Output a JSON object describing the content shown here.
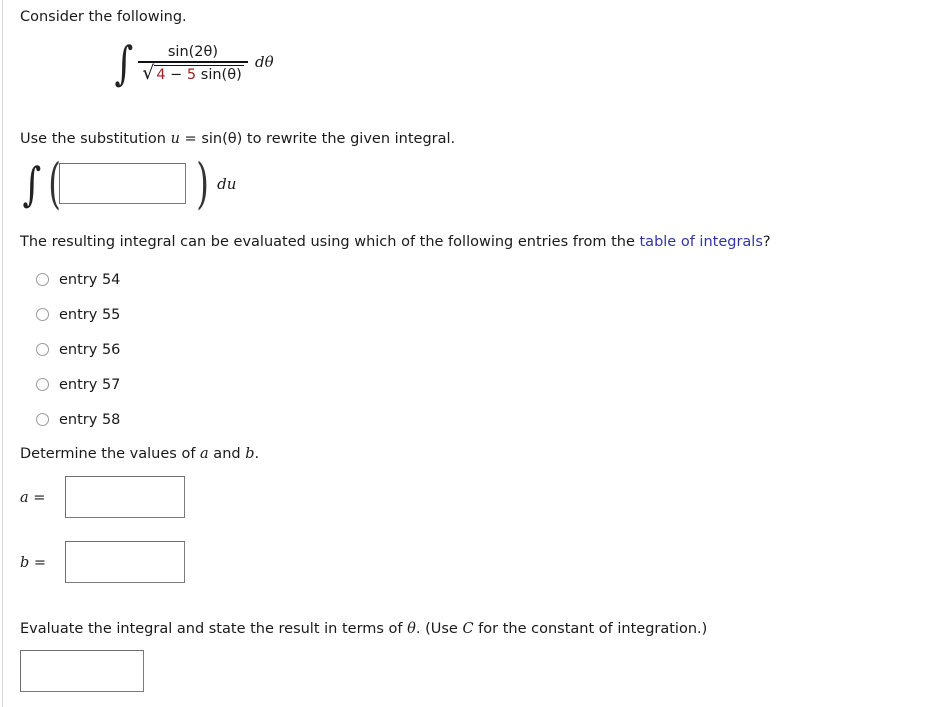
{
  "intro": {
    "text": "Consider the following."
  },
  "integral": {
    "integral_sign": "∫",
    "numerator": "sin(2θ)",
    "sqrt_glyph": "√",
    "denominator_a": "4",
    "denominator_op": " − ",
    "denominator_b": "5",
    "denominator_rest": " sin(θ)",
    "differential": "dθ"
  },
  "substitution": {
    "prefix": "Use the substitution ",
    "variable": "u",
    "equals": " = ",
    "expression": "sin(θ)",
    "suffix": " to rewrite the given integral.",
    "integral_sign": "∫",
    "open_paren": "(",
    "close_paren": ")",
    "differential": "du",
    "input_value": "",
    "input_placeholder": ""
  },
  "question": {
    "text_before_link": "The resulting integral can be evaluated using which of the following entries from the ",
    "link_text": "table of integrals",
    "text_after_link": "?",
    "link_color": "#3333a8",
    "options": [
      {
        "label": "entry 54",
        "selected": false
      },
      {
        "label": "entry 55",
        "selected": false
      },
      {
        "label": "entry 56",
        "selected": false
      },
      {
        "label": "entry 57",
        "selected": false
      },
      {
        "label": "entry 58",
        "selected": false
      }
    ]
  },
  "determine": {
    "prefix": "Determine the values of ",
    "var_a": "a",
    "conjunction": " and ",
    "var_b": "b",
    "period": ".",
    "a_label_var": "a",
    "a_label_eq": " =",
    "b_label_var": "b",
    "b_label_eq": " =",
    "a_value": "",
    "b_value": "",
    "a_placeholder": "",
    "b_placeholder": ""
  },
  "evaluate": {
    "text_1": "Evaluate the integral and state the result in terms of ",
    "theta": "θ",
    "text_2": ". (Use ",
    "constant": "C",
    "text_3": " for the constant of integration.)",
    "input_value": "",
    "input_placeholder": ""
  },
  "colors": {
    "accent_red": "#a32222",
    "link_blue": "#3333a8",
    "text": "#1a1a1a",
    "input_border": "#7a7a7a"
  }
}
